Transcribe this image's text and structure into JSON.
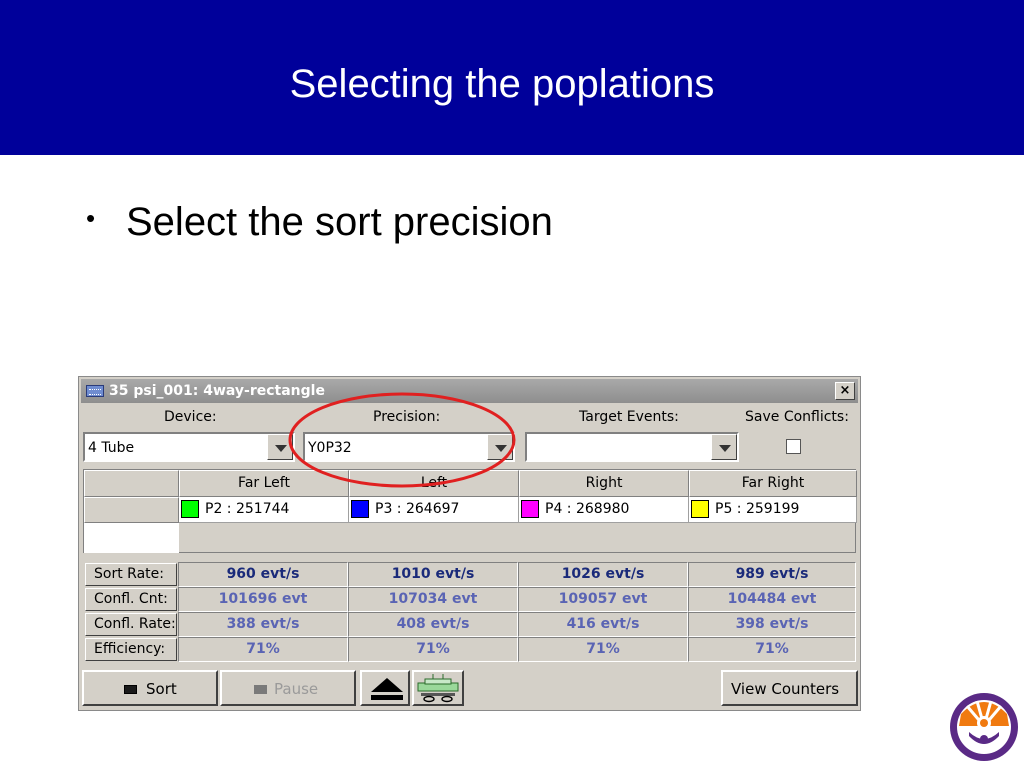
{
  "slide": {
    "title": "Selecting the poplations",
    "bullet": "•",
    "bullet_text": "Select the sort precision"
  },
  "window": {
    "title": "35 psi_001: 4way-rectangle",
    "close": "×",
    "labels": {
      "device": "Device:",
      "precision": "Precision:",
      "target_events": "Target Events:",
      "save_conflicts": "Save Conflicts:"
    },
    "device_value": "4 Tube",
    "precision_value": "Y0P32",
    "target_events_value": "",
    "save_conflicts_checked": false,
    "columns": [
      "Far Left",
      "Left",
      "Right",
      "Far Right"
    ],
    "populations": [
      {
        "label": "P2 : 251744",
        "color": "#00ff00"
      },
      {
        "label": "P3 : 264697",
        "color": "#0000ff"
      },
      {
        "label": "P4 : 268980",
        "color": "#ff00ff"
      },
      {
        "label": "P5 : 259199",
        "color": "#ffff00"
      }
    ],
    "stats": {
      "row_labels": [
        "Sort Rate:",
        "Confl. Cnt:",
        "Confl. Rate:",
        "Efficiency:"
      ],
      "rows": [
        [
          "960 evt/s",
          "1010 evt/s",
          "1026 evt/s",
          "989 evt/s"
        ],
        [
          "101696 evt",
          "107034 evt",
          "109057 evt",
          "104484 evt"
        ],
        [
          "388 evt/s",
          "408 evt/s",
          "416 evt/s",
          "398 evt/s"
        ],
        [
          "71%",
          "71%",
          "71%",
          "71%"
        ]
      ],
      "colors": [
        "#1a2a7a",
        "#5a64b4",
        "#5a64b4",
        "#5a64b4"
      ]
    },
    "buttons": {
      "sort": "Sort",
      "pause": "Pause",
      "view_counters": "View Counters"
    },
    "annotation_color": "#e02020"
  }
}
